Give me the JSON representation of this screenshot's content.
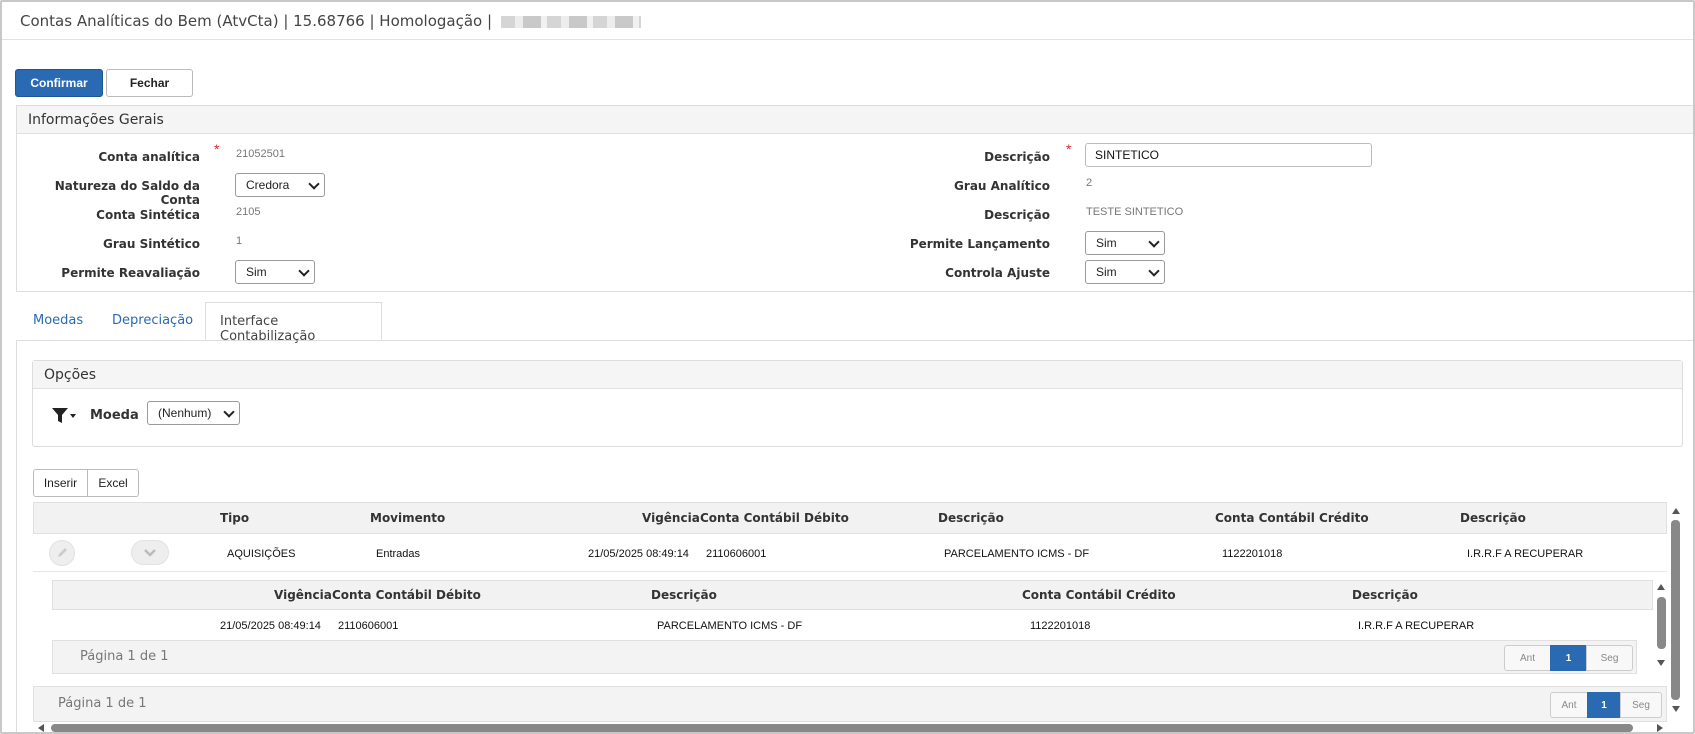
{
  "window": {
    "title": "Contas Analíticas do Bem (AtvCta) | 15.68766 | Homologação |"
  },
  "toolbar": {
    "confirm_label": "Confirmar",
    "close_label": "Fechar"
  },
  "general": {
    "title": "Informações Gerais",
    "conta_analitica_label": "Conta analítica",
    "conta_analitica_value": "21052501",
    "natureza_label": "Natureza do Saldo da Conta",
    "natureza_value": "Credora",
    "conta_sintetica_label": "Conta Sintética",
    "conta_sintetica_value": "2105",
    "grau_sintetico_label": "Grau Sintético",
    "grau_sintetico_value": "1",
    "permite_reavaliacao_label": "Permite Reavaliação",
    "permite_reavaliacao_value": "Sim",
    "descricao_label": "Descrição",
    "descricao_value": "SINTETICO",
    "grau_analitico_label": "Grau Analítico",
    "grau_analitico_value": "2",
    "descricao2_label": "Descrição",
    "descricao2_value": "TESTE SINTETICO",
    "permite_lancamento_label": "Permite Lançamento",
    "permite_lancamento_value": "Sim",
    "controla_ajuste_label": "Controla Ajuste",
    "controla_ajuste_value": "Sim",
    "required_mark": "*"
  },
  "tabs": [
    {
      "label": "Moedas"
    },
    {
      "label": "Depreciação"
    },
    {
      "label": "Interface Contabilização"
    }
  ],
  "options": {
    "title": "Opções",
    "moeda_label": "Moeda",
    "moeda_value": "(Nenhum)"
  },
  "grid_toolbar": {
    "insert_label": "Inserir",
    "excel_label": "Excel"
  },
  "main_grid": {
    "columns": [
      "Tipo",
      "Movimento",
      "Vigência",
      "Conta Contábil Débito",
      "Descrição",
      "Conta Contábil Crédito",
      "Descrição"
    ],
    "row": [
      "AQUISIÇÕES",
      "Entradas",
      "21/05/2025 08:49:14",
      "2110606001",
      "PARCELAMENTO ICMS - DF",
      "1122201018",
      "I.R.R.F A RECUPERAR"
    ],
    "pager_text": "Página 1 de 1",
    "pager_prev": "Ant",
    "pager_current": "1",
    "pager_next": "Seg"
  },
  "sub_grid": {
    "columns": [
      "Vigência",
      "Conta Contábil Débito",
      "Descrição",
      "Conta Contábil Crédito",
      "Descrição"
    ],
    "row": [
      "21/05/2025 08:49:14",
      "2110606001",
      "PARCELAMENTO ICMS - DF",
      "1122201018",
      "I.R.R.F A RECUPERAR"
    ],
    "pager_text": "Página 1 de 1",
    "pager_prev": "Ant",
    "pager_current": "1",
    "pager_next": "Seg"
  },
  "icons": {
    "edit": "pencil-icon",
    "expand": "chevron-down-icon",
    "filter": "filter-icon"
  }
}
